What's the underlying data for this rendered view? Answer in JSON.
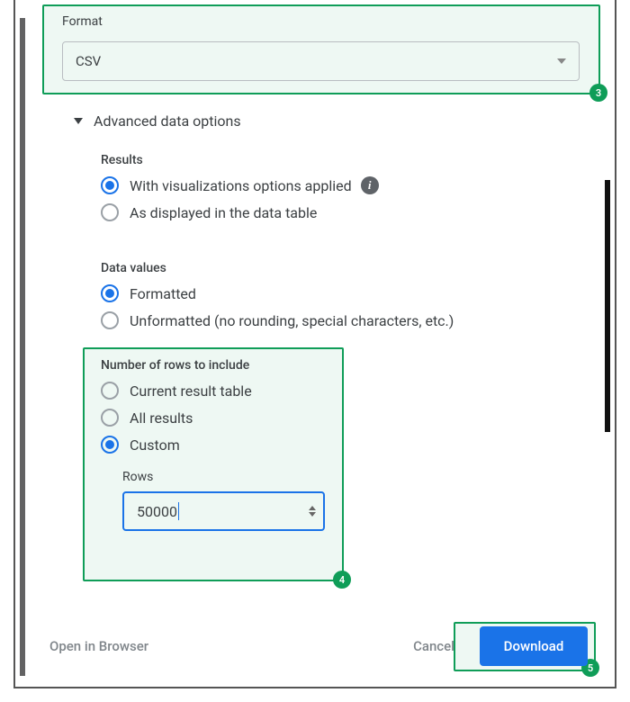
{
  "annotations": {
    "step3": "3",
    "step4": "4",
    "step5": "5"
  },
  "format": {
    "label": "Format",
    "value": "CSV"
  },
  "advanced": {
    "title": "Advanced data options",
    "results": {
      "heading": "Results",
      "opt1": "With visualizations options applied",
      "opt2": "As displayed in the data table"
    },
    "values": {
      "heading": "Data values",
      "opt1": "Formatted",
      "opt2": "Unformatted (no rounding, special characters, etc.)"
    },
    "rows": {
      "heading": "Number of rows to include",
      "opt1": "Current result table",
      "opt2": "All results",
      "opt3": "Custom",
      "input_label": "Rows",
      "input_value": "50000"
    }
  },
  "footer": {
    "open": "Open in Browser",
    "cancel": "Cancel",
    "download": "Download"
  }
}
